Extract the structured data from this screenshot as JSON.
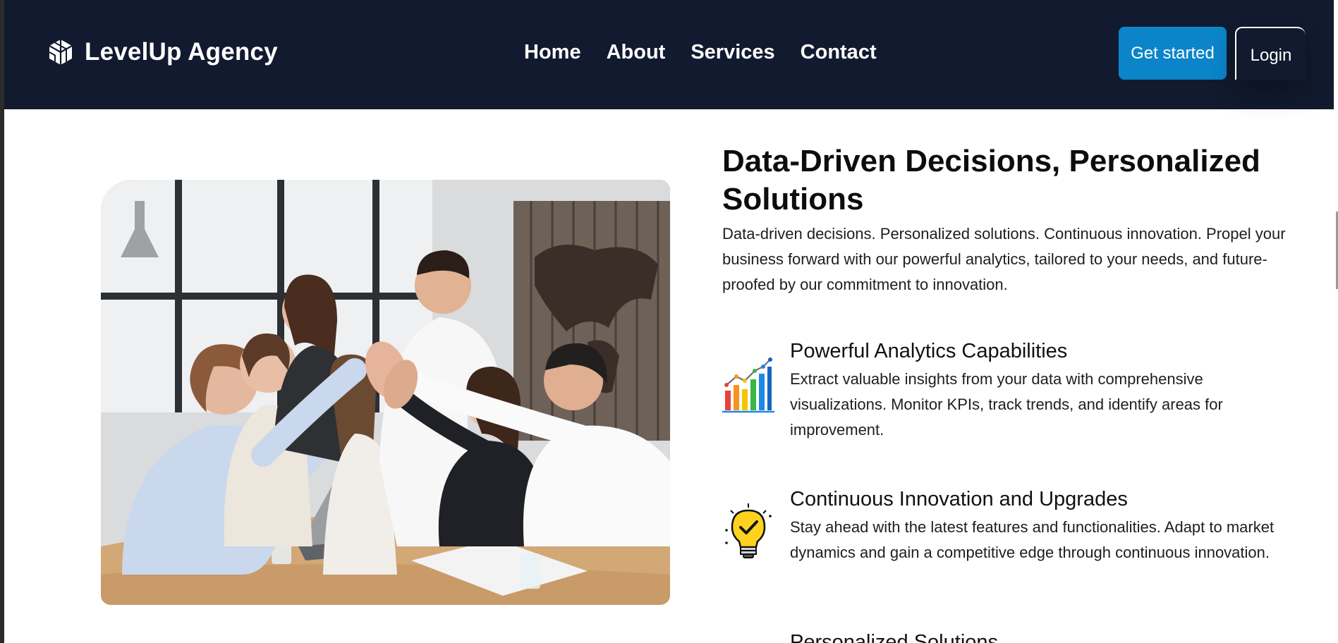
{
  "brand": {
    "name": "LevelUp Agency",
    "logo_icon": "cube-logo-icon"
  },
  "nav": {
    "links": [
      "Home",
      "About",
      "Services",
      "Contact"
    ]
  },
  "actions": {
    "get_started": "Get started",
    "login": "Login"
  },
  "colors": {
    "header_bg": "#111a2e",
    "accent": "#0b84c9",
    "text": "#0d0d0d"
  },
  "hero": {
    "image": "team-high-five-photo"
  },
  "main": {
    "headline": "Data-Driven Decisions, Personalized Solutions",
    "intro": "Data-driven decisions. Personalized solutions. Continuous innovation. Propel your business forward with our powerful analytics, tailored to your needs, and future-proofed by our commitment to innovation."
  },
  "features": [
    {
      "icon": "bar-chart-icon",
      "title": "Powerful Analytics Capabilities",
      "desc": "Extract valuable insights from your data with comprehensive visualizations. Monitor KPIs, track trends, and identify areas for improvement."
    },
    {
      "icon": "lightbulb-check-icon",
      "title": "Continuous Innovation and Upgrades",
      "desc": "Stay ahead with the latest features and functionalities. Adapt to market dynamics and gain a competitive edge through continuous innovation."
    },
    {
      "icon": "",
      "title": "Personalized Solutions",
      "desc": ""
    }
  ]
}
